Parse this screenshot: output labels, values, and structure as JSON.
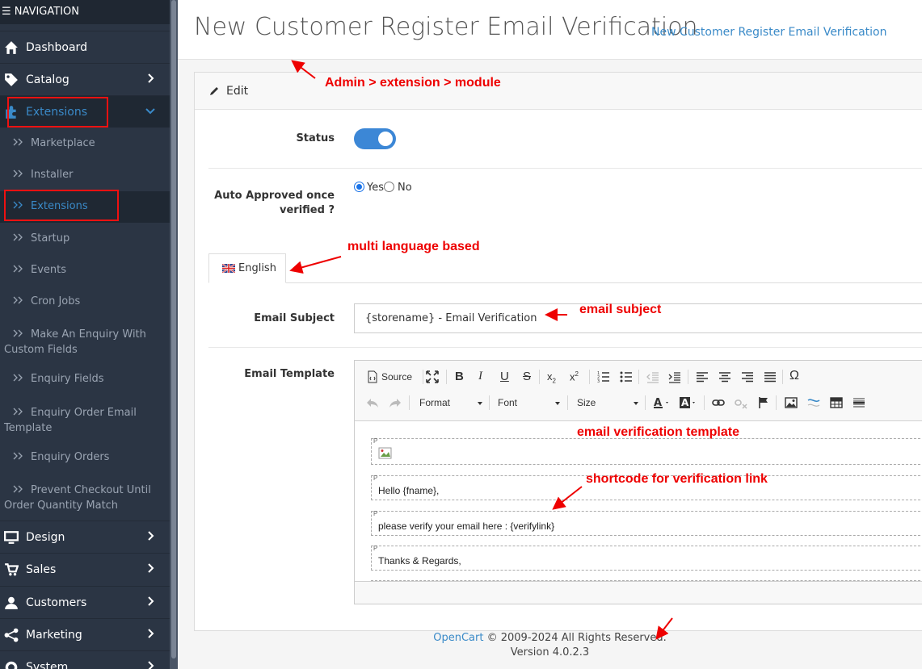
{
  "sidebar": {
    "header": "NAVIGATION",
    "items": [
      {
        "label": "Dashboard",
        "icon": "home-icon"
      },
      {
        "label": "Catalog",
        "icon": "tag-icon"
      },
      {
        "label": "Extensions",
        "icon": "puzzle-icon",
        "active": true
      },
      {
        "label": "Design",
        "icon": "monitor-icon"
      },
      {
        "label": "Sales",
        "icon": "cart-icon"
      },
      {
        "label": "Customers",
        "icon": "user-icon"
      },
      {
        "label": "Marketing",
        "icon": "share-icon"
      },
      {
        "label": "System",
        "icon": "cog-icon"
      }
    ],
    "subitems": [
      {
        "label": "Marketplace"
      },
      {
        "label": "Installer"
      },
      {
        "label": "Extensions",
        "active": true
      },
      {
        "label": "Startup"
      },
      {
        "label": "Events"
      },
      {
        "label": "Cron Jobs"
      },
      {
        "label1": "Make An Enquiry With",
        "label2": "Custom Fields"
      },
      {
        "label": "Enquiry Fields"
      },
      {
        "label1": "Enquiry Order Email",
        "label2": "Template"
      },
      {
        "label": "Enquiry Orders"
      },
      {
        "label1": "Prevent Checkout Until",
        "label2": "Order Quantity Match"
      }
    ]
  },
  "page": {
    "title": "New Customer Register Email Verification",
    "breadcrumb": "New Customer Register Email Verification"
  },
  "card": {
    "header": "Edit",
    "status_label": "Status",
    "status_on": true,
    "auto_label_line1": "Auto Approved once",
    "auto_label_line2": "verified ?",
    "yes_label": "Yes",
    "no_label": "No",
    "language_tab": "English",
    "subject_label": "Email Subject",
    "subject_value": "{storename} - Email Verification",
    "template_label": "Email Template"
  },
  "editor": {
    "source_label": "Source",
    "format_label": "Format",
    "font_label": "Font",
    "size_label": "Size",
    "paragraph_tag": "P",
    "lines": [
      "Hello {fname},",
      "please verify your email here : {verifylink}",
      "Thanks & Regards,"
    ]
  },
  "footer": {
    "link": "OpenCart",
    "copyright": " © 2009-2024 All Rights Reserved.",
    "version": "Version 4.0.2.3"
  },
  "annotations": {
    "path": "Admin > extension > module",
    "multi_lang": "multi language based",
    "email_subject": "email subject",
    "email_template": "email verification template",
    "shortcode": "shortcode for verification link"
  },
  "colors": {
    "sidebar_bg": "#2b3544",
    "accent": "#3c87d6",
    "annotation": "#ee0000",
    "link": "#3a8ac8"
  }
}
